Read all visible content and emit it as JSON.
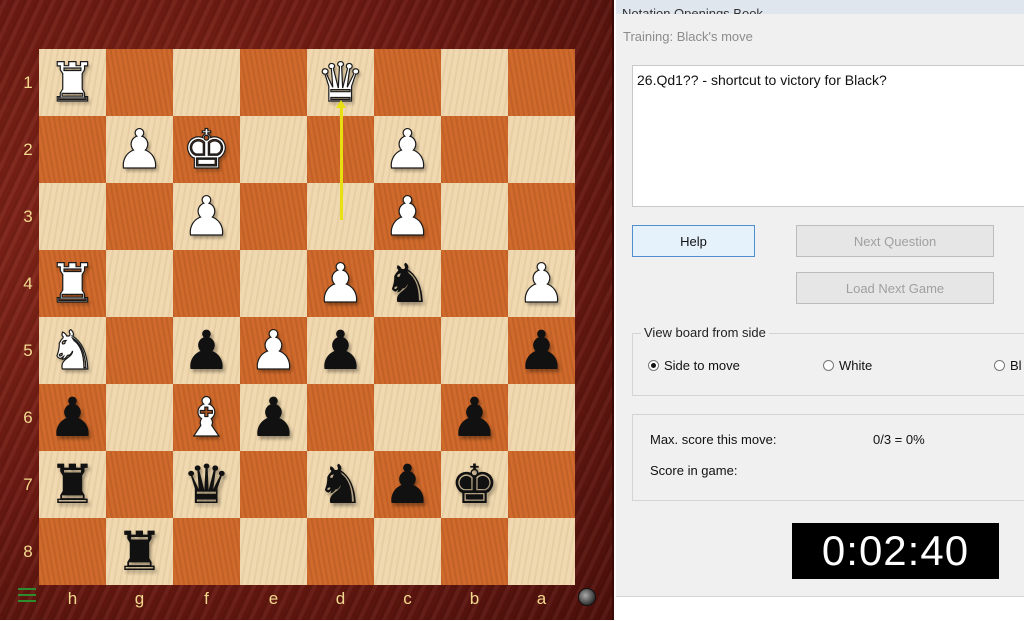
{
  "board": {
    "ranks": [
      "1",
      "2",
      "3",
      "4",
      "5",
      "6",
      "7",
      "8"
    ],
    "files": [
      "h",
      "g",
      "f",
      "e",
      "d",
      "c",
      "b",
      "a"
    ],
    "pieces": [
      {
        "row": 0,
        "col": 0,
        "glyph": "♜",
        "color": "w",
        "name": "white-rook-h1"
      },
      {
        "row": 0,
        "col": 4,
        "glyph": "♛",
        "color": "w",
        "name": "white-queen-d1"
      },
      {
        "row": 1,
        "col": 1,
        "glyph": "♟",
        "color": "w",
        "name": "white-pawn-g2"
      },
      {
        "row": 1,
        "col": 2,
        "glyph": "♚",
        "color": "w",
        "name": "white-king-f2"
      },
      {
        "row": 1,
        "col": 5,
        "glyph": "♟",
        "color": "w",
        "name": "white-pawn-c2"
      },
      {
        "row": 2,
        "col": 2,
        "glyph": "♟",
        "color": "w",
        "name": "white-pawn-f3"
      },
      {
        "row": 2,
        "col": 5,
        "glyph": "♟",
        "color": "w",
        "name": "white-pawn-c3"
      },
      {
        "row": 3,
        "col": 0,
        "glyph": "♜",
        "color": "w",
        "name": "white-rook-h4"
      },
      {
        "row": 3,
        "col": 4,
        "glyph": "♟",
        "color": "w",
        "name": "white-pawn-d4"
      },
      {
        "row": 3,
        "col": 5,
        "glyph": "♞",
        "color": "b",
        "name": "black-knight-c4"
      },
      {
        "row": 3,
        "col": 7,
        "glyph": "♟",
        "color": "w",
        "name": "white-pawn-a4"
      },
      {
        "row": 4,
        "col": 0,
        "glyph": "♞",
        "color": "w",
        "name": "white-knight-h5"
      },
      {
        "row": 4,
        "col": 2,
        "glyph": "♟",
        "color": "b",
        "name": "black-pawn-f5"
      },
      {
        "row": 4,
        "col": 3,
        "glyph": "♟",
        "color": "w",
        "name": "white-pawn-e5"
      },
      {
        "row": 4,
        "col": 4,
        "glyph": "♟",
        "color": "b",
        "name": "black-pawn-d5"
      },
      {
        "row": 4,
        "col": 7,
        "glyph": "♟",
        "color": "b",
        "name": "black-pawn-a5"
      },
      {
        "row": 5,
        "col": 0,
        "glyph": "♟",
        "color": "b",
        "name": "black-pawn-h6"
      },
      {
        "row": 5,
        "col": 2,
        "glyph": "♝",
        "color": "w",
        "name": "white-bishop-f6"
      },
      {
        "row": 5,
        "col": 3,
        "glyph": "♟",
        "color": "b",
        "name": "black-pawn-e6"
      },
      {
        "row": 5,
        "col": 6,
        "glyph": "♟",
        "color": "b",
        "name": "black-pawn-b6"
      },
      {
        "row": 6,
        "col": 0,
        "glyph": "♜",
        "color": "b",
        "name": "black-rook-h7"
      },
      {
        "row": 6,
        "col": 2,
        "glyph": "♛",
        "color": "b",
        "name": "black-queen-f7"
      },
      {
        "row": 6,
        "col": 4,
        "glyph": "♞",
        "color": "b",
        "name": "black-knight-d7"
      },
      {
        "row": 6,
        "col": 5,
        "glyph": "♟",
        "color": "b",
        "name": "black-pawn-c7"
      },
      {
        "row": 6,
        "col": 6,
        "glyph": "♚",
        "color": "b",
        "name": "black-king-b7"
      },
      {
        "row": 7,
        "col": 1,
        "glyph": "♜",
        "color": "b",
        "name": "black-rook-g8"
      }
    ],
    "arrow": {
      "from": "d3",
      "to": "d1",
      "color": "#e8e010"
    },
    "light_color": "#f0d9b0",
    "dark_color": "#cf6a2c"
  },
  "panel": {
    "tabs_text": "Notation    Openings Book",
    "training_title": "Training: Black's move",
    "comment": "26.Qd1?? - shortcut to victory for Black?",
    "help_label": "Help",
    "next_question_label": "Next Question",
    "load_next_game_label": "Load Next Game",
    "view_board_label": "View board from side",
    "side_options": [
      {
        "label": "Side to move",
        "selected": true
      },
      {
        "label": "White",
        "selected": false
      },
      {
        "label": "Bl",
        "selected": false
      }
    ],
    "max_score_label": "Max. score this move:",
    "max_score_value": "0/3 =  0%",
    "score_in_game_label": "Score in game:",
    "timer": "0:02:40"
  }
}
